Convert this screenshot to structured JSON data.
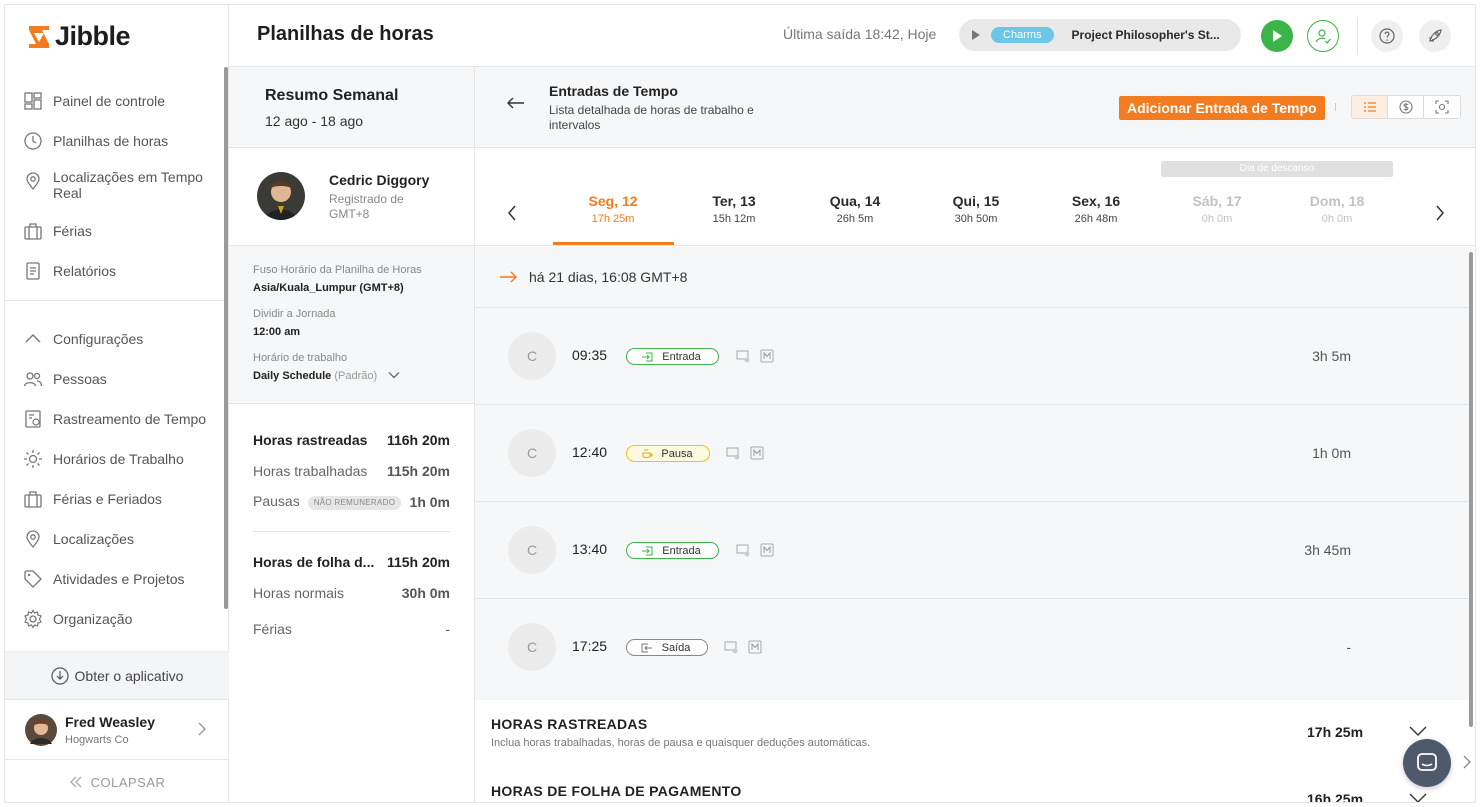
{
  "app": {
    "logo_text": "Jibble"
  },
  "header": {
    "title": "Planilhas de horas",
    "last_out": "Última saída 18:42, Hoje",
    "timer": {
      "tag": "Charms",
      "project": "Project Philosopher's St..."
    }
  },
  "sidebar": {
    "items": [
      {
        "label": "Painel de controle",
        "icon": "dashboard-icon"
      },
      {
        "label": "Planilhas de horas",
        "icon": "clock-icon"
      },
      {
        "label": "Localizações em Tempo Real",
        "icon": "location-pin-icon"
      },
      {
        "label": "Férias",
        "icon": "suitcase-icon"
      },
      {
        "label": "Relatórios",
        "icon": "report-icon"
      }
    ],
    "settings_items": [
      {
        "label": "Configurações",
        "icon": "chevron-up-icon"
      },
      {
        "label": "Pessoas",
        "icon": "people-icon"
      },
      {
        "label": "Rastreamento de Tempo",
        "icon": "time-tracking-icon"
      },
      {
        "label": "Horários de Trabalho",
        "icon": "sun-icon"
      },
      {
        "label": "Férias e Feriados",
        "icon": "suitcase-icon"
      },
      {
        "label": "Localizações",
        "icon": "location-pin-icon"
      },
      {
        "label": "Atividades e Projetos",
        "icon": "tag-icon"
      },
      {
        "label": "Organização",
        "icon": "gear-icon"
      }
    ],
    "get_app": "Obter o aplicativo",
    "user": {
      "name": "Fred Weasley",
      "org": "Hogwarts Co"
    },
    "collapse": "COLAPSAR"
  },
  "summary": {
    "title": "Resumo Semanal",
    "range": "12 ago - 18 ago",
    "employee": {
      "name": "Cedric Diggory",
      "registered": "Registrado de GMT+8"
    },
    "settings": {
      "timezone_label": "Fuso Horário da Planilha de Horas",
      "timezone_value": "Asia/Kuala_Lumpur (GMT+8)",
      "split_label": "Dividir a Jornada",
      "split_value": "12:00 am",
      "schedule_label": "Horário de trabalho",
      "schedule_value": "Daily Schedule",
      "schedule_default": "(Padrão)"
    },
    "tracked_label": "Horas rastreadas",
    "tracked_value": "116h 20m",
    "worked_label": "Horas trabalhadas",
    "worked_value": "115h 20m",
    "breaks_label": "Pausas",
    "breaks_badge": "NÃO REMUNERADO",
    "breaks_value": "1h 0m",
    "payroll_label": "Horas de folha d...",
    "payroll_value": "115h 20m",
    "regular_label": "Horas normais",
    "regular_value": "30h 0m",
    "leave_label": "Férias",
    "leave_value": "-"
  },
  "main": {
    "title": "Entradas de Tempo",
    "subtitle": "Lista detalhada de horas de trabalho e intervalos",
    "add_button": "Adicionar Entrada de Tempo",
    "rest_day_label": "Dia de descanso",
    "days": [
      {
        "name": "Seg, 12",
        "hours": "17h 25m",
        "state": "active"
      },
      {
        "name": "Ter, 13",
        "hours": "15h 12m",
        "state": "normal"
      },
      {
        "name": "Qua, 14",
        "hours": "26h 5m",
        "state": "normal"
      },
      {
        "name": "Qui, 15",
        "hours": "30h 50m",
        "state": "normal"
      },
      {
        "name": "Sex, 16",
        "hours": "26h 48m",
        "state": "normal"
      },
      {
        "name": "Sáb, 17",
        "hours": "0h 0m",
        "state": "off"
      },
      {
        "name": "Dom, 18",
        "hours": "0h 0m",
        "state": "off"
      }
    ],
    "ago": "há 21 dias, 16:08 GMT+8",
    "entries": [
      {
        "avatar": "C",
        "time": "09:35",
        "type": "Entrada",
        "kind": "in",
        "duration": "3h 5m"
      },
      {
        "avatar": "C",
        "time": "12:40",
        "type": "Pausa",
        "kind": "break",
        "duration": "1h 0m"
      },
      {
        "avatar": "C",
        "time": "13:40",
        "type": "Entrada",
        "kind": "in",
        "duration": "3h 45m"
      },
      {
        "avatar": "C",
        "time": "17:25",
        "type": "Saída",
        "kind": "out",
        "duration": "-"
      }
    ],
    "totals": [
      {
        "title": "HORAS RASTREADAS",
        "subtitle": "Inclua horas trabalhadas, horas de pausa e quaisquer deduções automáticas.",
        "value": "17h 25m"
      },
      {
        "title": "HORAS DE FOLHA DE PAGAMENTO",
        "subtitle": "",
        "value": "16h 25m"
      }
    ]
  },
  "colors": {
    "accent": "#f47c20",
    "clock_in": "#3bb44a",
    "break": "#f3c11c",
    "tag": "#6cc6e8"
  }
}
